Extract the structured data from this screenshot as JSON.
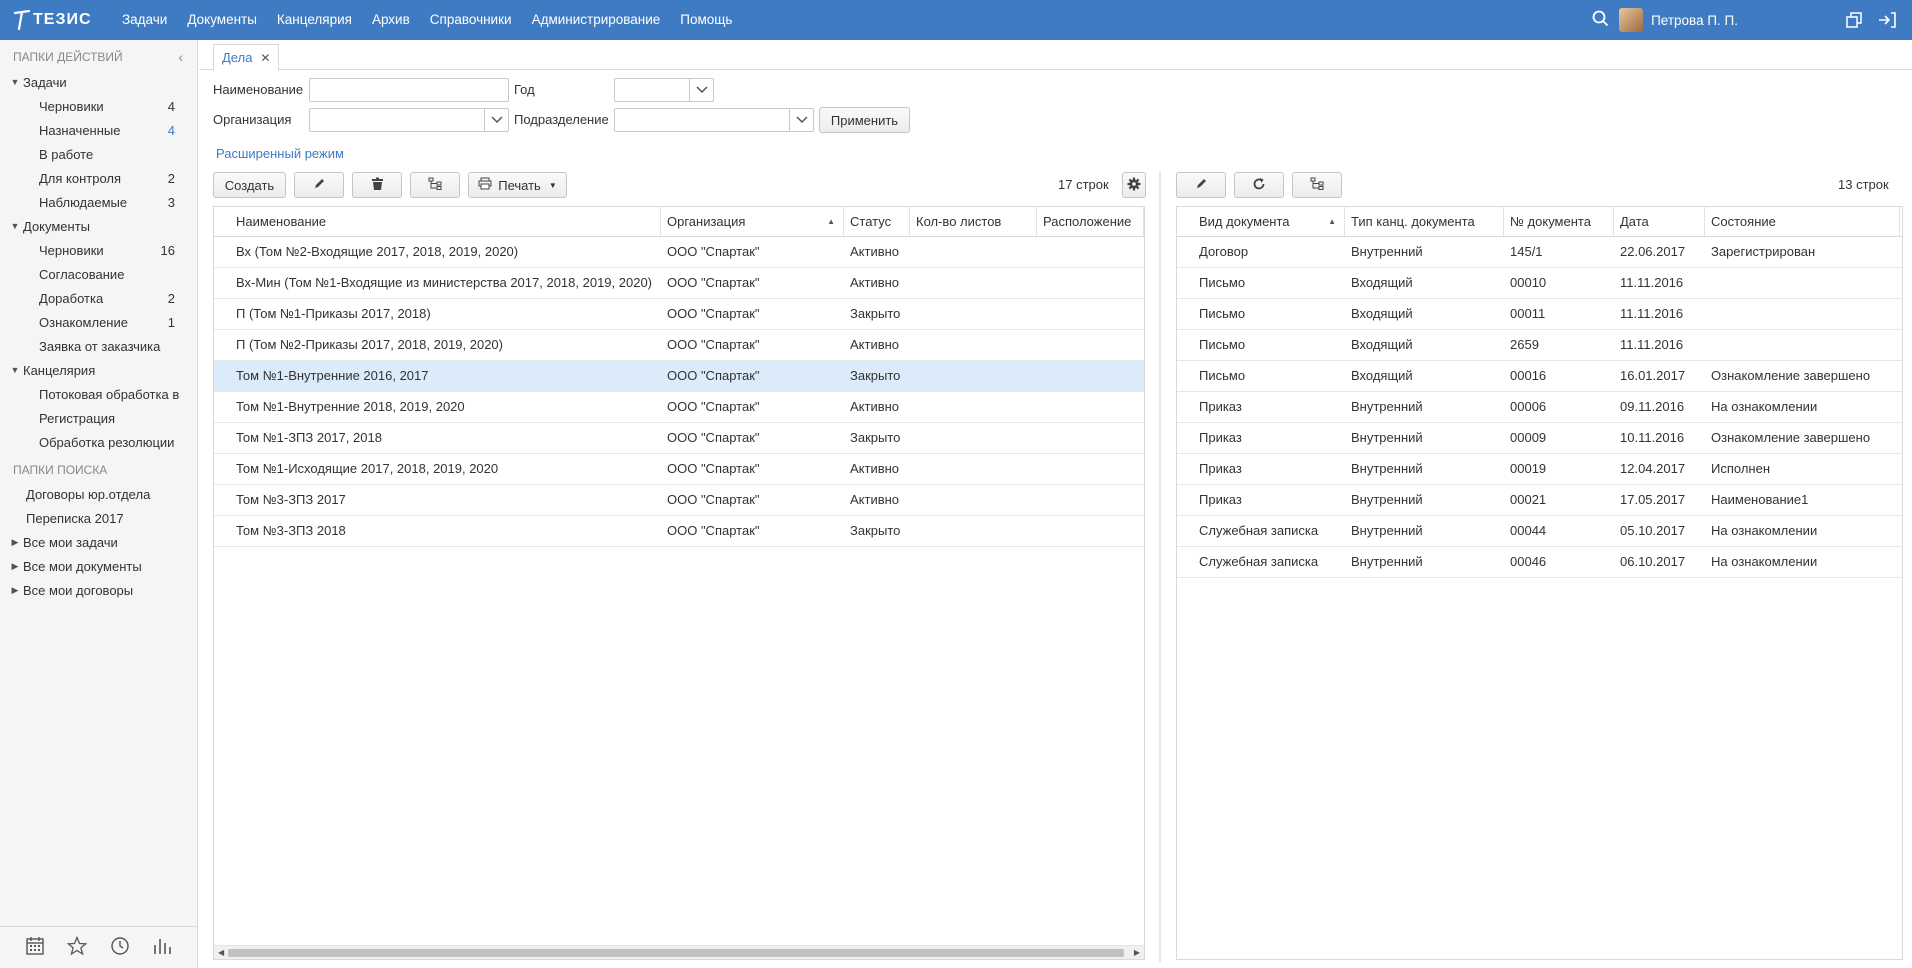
{
  "app": {
    "logo_text": "ТЕЗИС",
    "user_name": "Петрова П. П."
  },
  "topmenu": [
    "Задачи",
    "Документы",
    "Канцелярия",
    "Архив",
    "Справочники",
    "Администрирование",
    "Помощь"
  ],
  "sidebar": {
    "actions_header": "ПАПКИ ДЕЙСТВИЙ",
    "groups": [
      {
        "label": "Задачи",
        "items": [
          {
            "label": "Черновики",
            "count": "4",
            "highlight": false
          },
          {
            "label": "Назначенные",
            "count": "4",
            "highlight": true
          },
          {
            "label": "В работе",
            "count": "",
            "highlight": false
          },
          {
            "label": "Для контроля",
            "count": "2",
            "highlight": false
          },
          {
            "label": "Наблюдаемые",
            "count": "3",
            "highlight": false
          }
        ]
      },
      {
        "label": "Документы",
        "items": [
          {
            "label": "Черновики",
            "count": "16",
            "highlight": false
          },
          {
            "label": "Согласование",
            "count": "",
            "highlight": false
          },
          {
            "label": "Доработка",
            "count": "2",
            "highlight": false
          },
          {
            "label": "Ознакомление",
            "count": "1",
            "highlight": false
          },
          {
            "label": "Заявка от заказчика",
            "count": "",
            "highlight": false
          }
        ]
      },
      {
        "label": "Канцелярия",
        "items": [
          {
            "label": "Потоковая обработка в",
            "count": "",
            "highlight": false
          },
          {
            "label": "Регистрация",
            "count": "",
            "highlight": false
          },
          {
            "label": "Обработка резолюции",
            "count": "",
            "highlight": false
          }
        ]
      }
    ],
    "search_header": "ПАПКИ ПОИСКА",
    "search_items": [
      "Договоры юр.отдела",
      "Переписка 2017"
    ],
    "search_groups": [
      "Все мои задачи",
      "Все мои документы",
      "Все мои договоры"
    ]
  },
  "tab": {
    "label": "Дела"
  },
  "filter": {
    "name_label": "Наименование",
    "year_label": "Год",
    "org_label": "Организация",
    "dept_label": "Подразделение",
    "apply_label": "Применить",
    "advanced_label": "Расширенный режим"
  },
  "left_toolbar": {
    "create_label": "Создать",
    "print_label": "Печать",
    "row_count": "17 строк"
  },
  "right_toolbar": {
    "row_count": "13 строк"
  },
  "left_table": {
    "columns": [
      "Наименование",
      "Организация",
      "Статус",
      "Кол-во листов",
      "Расположение"
    ],
    "rows": [
      [
        "Вх (Том №2-Входящие 2017, 2018, 2019, 2020)",
        "ООО \"Спартак\"",
        "Активно",
        "",
        ""
      ],
      [
        "Вх-Мин (Том №1-Входящие из министерства 2017, 2018, 2019, 2020)",
        "ООО \"Спартак\"",
        "Активно",
        "",
        ""
      ],
      [
        "П (Том №1-Приказы 2017, 2018)",
        "ООО \"Спартак\"",
        "Закрыто",
        "",
        ""
      ],
      [
        "П (Том №2-Приказы 2017, 2018, 2019, 2020)",
        "ООО \"Спартак\"",
        "Активно",
        "",
        ""
      ],
      [
        "Том №1-Внутренние 2016, 2017",
        "ООО \"Спартак\"",
        "Закрыто",
        "",
        ""
      ],
      [
        "Том №1-Внутренние 2018, 2019, 2020",
        "ООО \"Спартак\"",
        "Активно",
        "",
        ""
      ],
      [
        "Том №1-ЗПЗ 2017, 2018",
        "ООО \"Спартак\"",
        "Закрыто",
        "",
        ""
      ],
      [
        "Том №1-Исходящие 2017, 2018, 2019, 2020",
        "ООО \"Спартак\"",
        "Активно",
        "",
        ""
      ],
      [
        "Том №3-ЗПЗ 2017",
        "ООО \"Спартак\"",
        "Активно",
        "",
        ""
      ],
      [
        "Том №3-ЗПЗ 2018",
        "ООО \"Спартак\"",
        "Закрыто",
        "",
        ""
      ]
    ],
    "selected_row": 4
  },
  "right_table": {
    "columns": [
      "Вид документа",
      "Тип канц. документа",
      "№ документа",
      "Дата",
      "Состояние"
    ],
    "rows": [
      [
        "Договор",
        "Внутренний",
        "145/1",
        "22.06.2017",
        "Зарегистрирован"
      ],
      [
        "Письмо",
        "Входящий",
        "00010",
        "11.11.2016",
        ""
      ],
      [
        "Письмо",
        "Входящий",
        "00011",
        "11.11.2016",
        ""
      ],
      [
        "Письмо",
        "Входящий",
        "2659",
        "11.11.2016",
        ""
      ],
      [
        "Письмо",
        "Входящий",
        "00016",
        "16.01.2017",
        "Ознакомление завершено"
      ],
      [
        "Приказ",
        "Внутренний",
        "00006",
        "09.11.2016",
        "На ознакомлении"
      ],
      [
        "Приказ",
        "Внутренний",
        "00009",
        "10.11.2016",
        "Ознакомление завершено"
      ],
      [
        "Приказ",
        "Внутренний",
        "00019",
        "12.04.2017",
        "Исполнен"
      ],
      [
        "Приказ",
        "Внутренний",
        "00021",
        "17.05.2017",
        "Наименование1"
      ],
      [
        "Служебная записка",
        "Внутренний",
        "00044",
        "05.10.2017",
        "На ознакомлении"
      ],
      [
        "Служебная записка",
        "Внутренний",
        "00046",
        "06.10.2017",
        "На ознакомлении"
      ]
    ]
  },
  "colors": {
    "brand": "#3e7bc3",
    "selected_row": "#dcebf9"
  }
}
